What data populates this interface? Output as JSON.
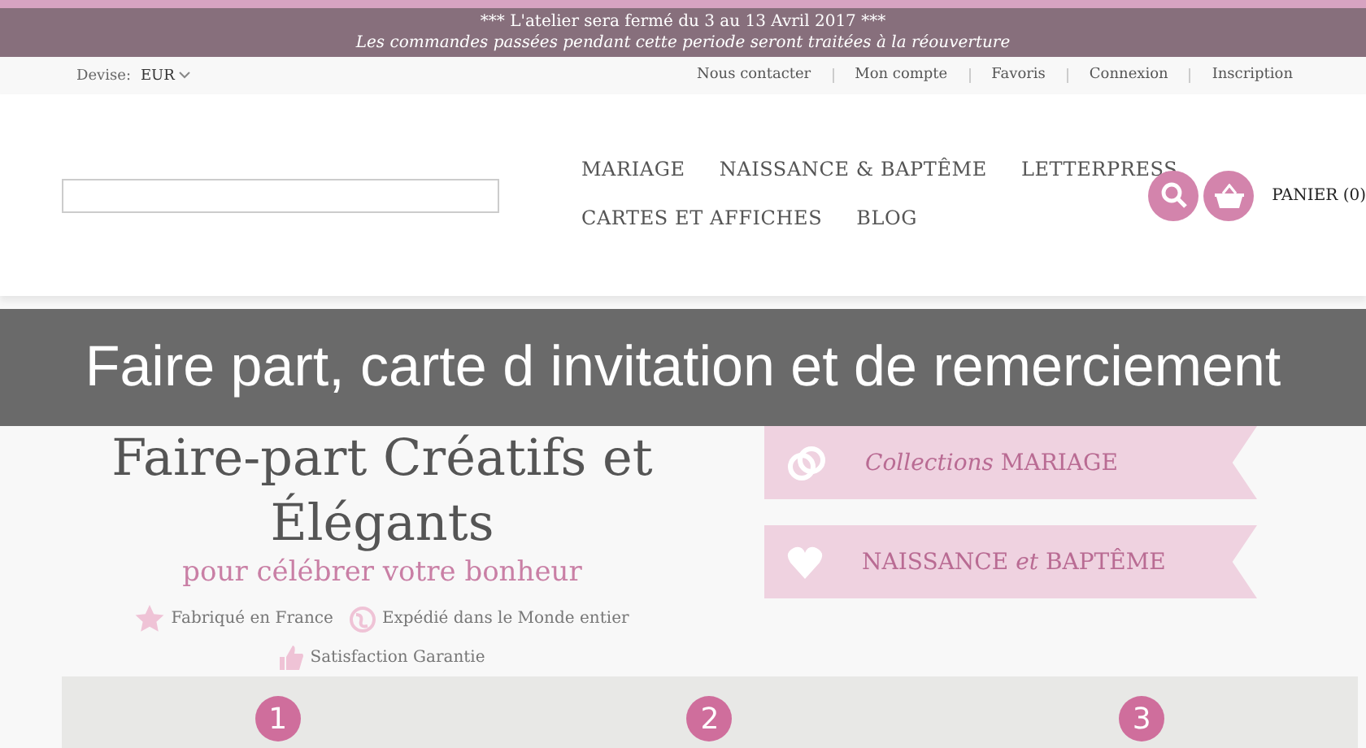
{
  "announcement": {
    "title": "*** L'atelier sera fermé du 3 au 13 Avril 2017 ***",
    "subtitle": "Les commandes passées pendant cette periode seront traitées à la réouverture"
  },
  "top_bar": {
    "currency_label": "Devise:",
    "currency": "EUR",
    "links": [
      "Nous contacter",
      "Mon compte",
      "Favoris",
      "Connexion",
      "Inscription"
    ]
  },
  "nav": {
    "rows": [
      [
        "MARIAGE",
        "NAISSANCE & BAPTÊME",
        "LETTERPRESS"
      ],
      [
        "CARTES ET AFFICHES",
        "BLOG"
      ]
    ],
    "cart": "PANIER (0)"
  },
  "hero": {
    "title": "Faire-part Créatifs et Élégants",
    "subtitle": "pour célébrer votre bonheur",
    "features": [
      {
        "kind": "star",
        "text": "Fabriqué en France"
      },
      {
        "kind": "globe",
        "text": "Expédié dans le Monde entier"
      },
      {
        "kind": "thumb",
        "text": "Satisfaction Garantie"
      }
    ],
    "ribbons": [
      {
        "kind": "rings",
        "text": "*Collections* MARIAGE"
      },
      {
        "kind": "heart",
        "text": "NAISSANCE *et* BAPTÊME"
      }
    ],
    "steps": [
      "1",
      "2",
      "3"
    ]
  },
  "caption": "Faire part, carte d invitation et de remerciement"
}
